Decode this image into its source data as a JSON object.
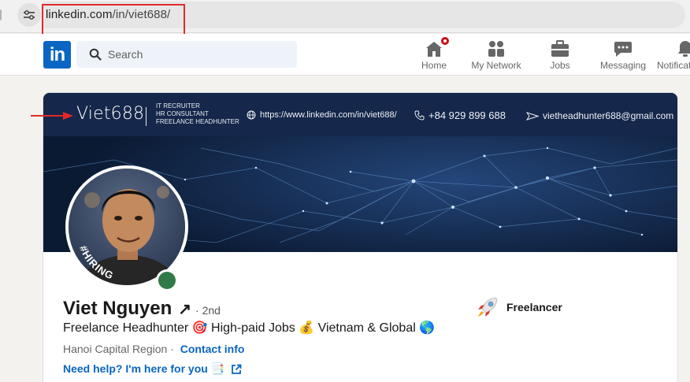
{
  "browser": {
    "url_host": "linkedin.com",
    "url_path": "/in/viet688/"
  },
  "nav": {
    "logo": "in",
    "search_placeholder": "Search",
    "items": [
      {
        "label": "Home",
        "icon": "home-icon"
      },
      {
        "label": "My Network",
        "icon": "network-icon"
      },
      {
        "label": "Jobs",
        "icon": "briefcase-icon"
      },
      {
        "label": "Messaging",
        "icon": "messaging-icon"
      },
      {
        "label": "Notifications",
        "icon": "bell-icon"
      }
    ]
  },
  "banner": {
    "brand": "Viet688",
    "roles": [
      "IT RECRUITER",
      "HR CONSULTANT",
      "FREELANCE HEADHUNTER"
    ],
    "website": "https://www.linkedin.com/in/viet688/",
    "phone": "+84 929 899 688",
    "email": "vietheadhunter688@gmail.com"
  },
  "profile": {
    "avatar_frame_text": "#HIRING",
    "name": "Viet Nguyen",
    "degree": "· 2nd",
    "headline": "Freelance Headhunter 🎯 High-paid Jobs 💰 Vietnam & Global 🌎",
    "location": "Hanoi Capital Region",
    "contact_info": "Contact info",
    "help_link": "Need help? I'm here for you 📑",
    "company": "Freelancer"
  },
  "colors": {
    "linkedin_blue": "#0a66c2",
    "annotation_red": "#e02a2a",
    "online_green": "#2f7a47",
    "banner_dark": "#0b1a33"
  }
}
